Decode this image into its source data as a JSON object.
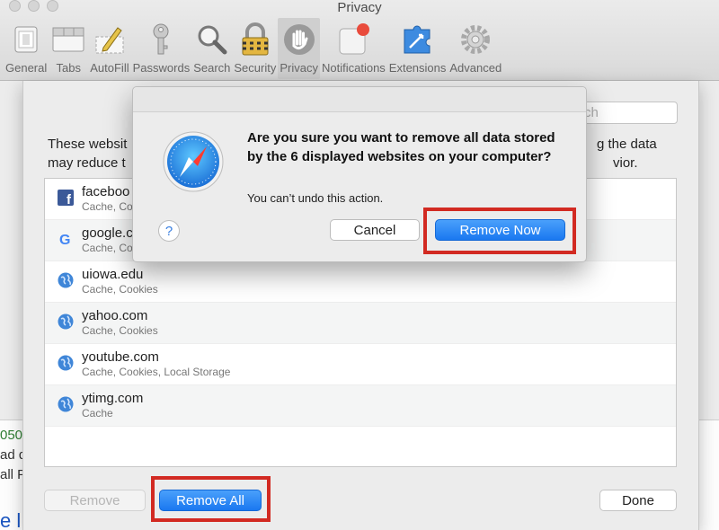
{
  "window": {
    "title": "Privacy"
  },
  "toolbar": {
    "items": [
      {
        "label": "General",
        "icon": "general-icon"
      },
      {
        "label": "Tabs",
        "icon": "tabs-icon"
      },
      {
        "label": "AutoFill",
        "icon": "autofill-icon"
      },
      {
        "label": "Passwords",
        "icon": "key-icon"
      },
      {
        "label": "Search",
        "icon": "magnifier-icon"
      },
      {
        "label": "Security",
        "icon": "lock-icon"
      },
      {
        "label": "Privacy",
        "icon": "hand-icon",
        "selected": true
      },
      {
        "label": "Notifications",
        "icon": "notifications-icon"
      },
      {
        "label": "Extensions",
        "icon": "puzzle-icon"
      },
      {
        "label": "Advanced",
        "icon": "gear-icon"
      }
    ]
  },
  "panel": {
    "search_placeholder": "rch",
    "description_line1_left": "These websit",
    "description_line1_right": "g the data",
    "description_line2_left": "may reduce t",
    "description_line2_right": "vior.",
    "sites": [
      {
        "name": "faceboo",
        "details": "Cache, Co",
        "icon": "facebook-icon"
      },
      {
        "name": "google.c",
        "details": "Cache, Co",
        "icon": "google-icon"
      },
      {
        "name": "uiowa.edu",
        "details": "Cache, Cookies",
        "icon": "globe-icon"
      },
      {
        "name": "yahoo.com",
        "details": "Cache, Cookies",
        "icon": "globe-icon"
      },
      {
        "name": "youtube.com",
        "details": "Cache, Cookies, Local Storage",
        "icon": "globe-icon"
      },
      {
        "name": "ytimg.com",
        "details": "Cache",
        "icon": "globe-icon"
      }
    ],
    "remove_label": "Remove",
    "remove_all_label": "Remove All",
    "done_label": "Done"
  },
  "dialog": {
    "title": "Are you sure you want to remove all data stored by the 6 displayed websites on your computer?",
    "subtitle": "You can’t undo this action.",
    "help_label": "?",
    "cancel_label": "Cancel",
    "remove_now_label": "Remove Now",
    "icon": "safari-compass-icon"
  },
  "background": {
    "frag1": "050",
    "frag2": "ad d",
    "frag3": "all P",
    "frag4": "e l"
  },
  "colors": {
    "accent_blue": "#1a78f0",
    "highlight_red": "#d22a22"
  }
}
